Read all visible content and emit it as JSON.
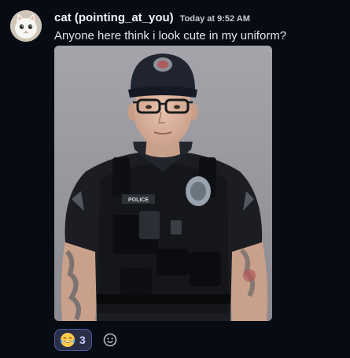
{
  "message": {
    "author": "cat (pointing_at_you)",
    "timestamp": "Today at 9:52 AM",
    "text": "Anyone here think i look cute in my uniform?"
  },
  "attachment": {
    "icon": "photo-of-police-officer-image",
    "badge_text": "POLICE"
  },
  "reactions": [
    {
      "icon": "joy-emoji-icon",
      "count": "3"
    }
  ],
  "add_reaction": {
    "icon": "add-reaction-smiley-icon"
  },
  "colors": {
    "background": "#070b14",
    "reaction_bg": "#2a2f48",
    "reaction_border": "#4e5a9c",
    "reaction_count": "#c9cdfb"
  }
}
